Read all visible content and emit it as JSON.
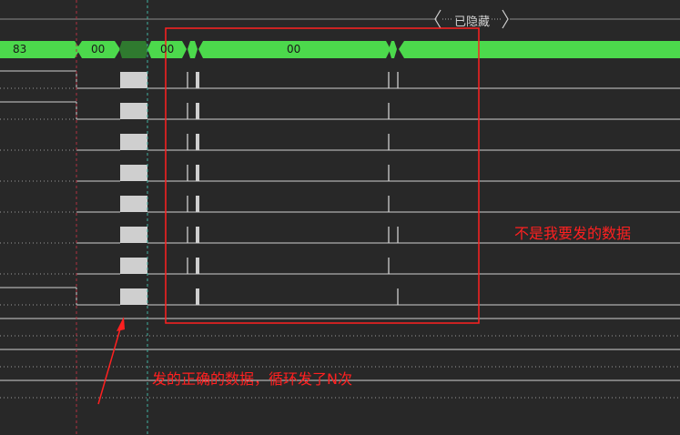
{
  "hidden_marker": {
    "label": "已隐藏"
  },
  "bus": {
    "segments": [
      {
        "text": "83"
      },
      {
        "text": "00"
      },
      {
        "text": ""
      },
      {
        "text": "00"
      },
      {
        "text": ""
      },
      {
        "text": "00"
      },
      {
        "text": ""
      }
    ]
  },
  "annotations": {
    "right_note": "不是我要发的数据",
    "bottom_note": "发的正确的数据，循环发了N次"
  },
  "colors": {
    "background": "#282828",
    "bus_fill": "#4cd94c",
    "bus_selected": "#2f7a2f",
    "signal_line": "#cfcfcf",
    "annotation": "#ff2020",
    "cursor_red": "#b03040",
    "cursor_cyan": "#40b0a0"
  },
  "channel_count": 11
}
